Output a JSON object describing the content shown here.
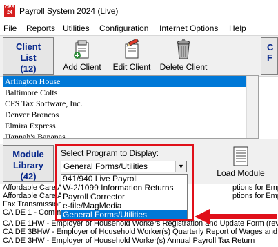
{
  "window": {
    "title": "Payroll System 2024 (Live)",
    "icon_text": "CFS 24"
  },
  "menu": [
    "File",
    "Reports",
    "Utilities",
    "Configuration",
    "Internet Options",
    "Help"
  ],
  "client_header": {
    "line1": "Client",
    "line2": "List",
    "line3": "(12)"
  },
  "toolbar": {
    "add_client": "Add Client",
    "edit_client": "Edit Client",
    "delete_client": "Delete Client"
  },
  "right_panel": {
    "letter1": "C",
    "letter2": "F"
  },
  "clients": [
    "Arlington House",
    "Baltimore Colts",
    "CFS Tax Software, Inc.",
    "Denver Broncos",
    "Elmira Express",
    "Hannah's Bananas"
  ],
  "module_header": {
    "line1": "Module",
    "line2": "Library",
    "line3": "(42)"
  },
  "program_select": {
    "label": "Select Program to Display:",
    "value": "General Forms/Utilities",
    "options": [
      "941/940 Live Payroll",
      "W-2/1099 Information Returns",
      "Payroll Corrector",
      "e-file/MagMedia",
      "General Forms/Utilities"
    ],
    "selected_index": 4
  },
  "load_module": {
    "label": "Load Module"
  },
  "modules": [
    "Affordable Care Ac",
    "Affordable Care Ac",
    "Fax Transmission",
    "CA DE 1 - Comm",
    "CA DE 1HW - Employer of Household Workers Registration and Update Form (rev.",
    "CA DE 3BHW - Employer of Household Worker(s) Quarterly Report of Wages and W",
    "CA DE 3HW - Employer of Household Worker(s) Annual Payroll Tax Return"
  ],
  "module_tails": {
    "row1": "ptions for Employers with Hea",
    "row2": "ptions for Employers without"
  },
  "colors": {
    "highlight": "#0078d7",
    "header_text": "#0a2a8c",
    "annotation_red": "#e0101a"
  }
}
